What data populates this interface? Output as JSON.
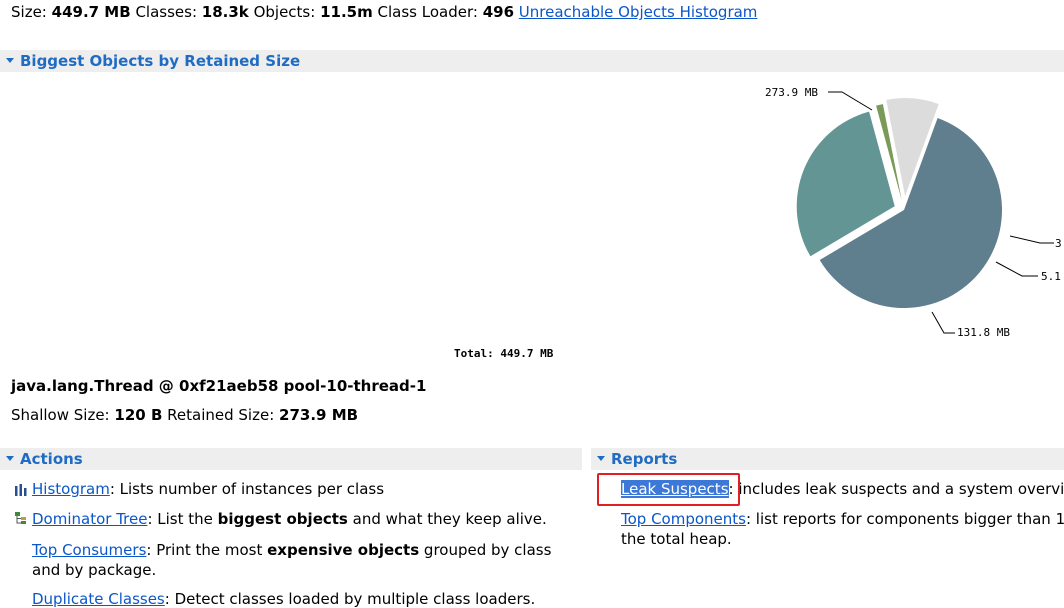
{
  "summary": {
    "size_label": "Size:",
    "size_value": "449.7 MB",
    "classes_label": "Classes:",
    "classes_value": "18.3k",
    "objects_label": "Objects:",
    "objects_value": "11.5m",
    "loader_label": "Class Loader:",
    "loader_value": "496",
    "unreachable_link": "Unreachable Objects Histogram"
  },
  "biggest": {
    "header": "Biggest Objects by Retained Size",
    "total_label": "Total:",
    "total_value": "449.7 MB"
  },
  "chart_data": {
    "type": "pie",
    "total": "449.7 MB",
    "slices": [
      {
        "label": "273.9 MB",
        "value": 273.9,
        "color": "#5f7e8e"
      },
      {
        "label": "131.8 MB",
        "value": 131.8,
        "color": "#629594"
      },
      {
        "label": "5.1",
        "value": 5.1,
        "color": "#7a9a5a"
      },
      {
        "label": "3",
        "value": 38.9,
        "color": "#dcdcdc"
      }
    ]
  },
  "object": {
    "title": "java.lang.Thread @ 0xf21aeb58 pool-10-thread-1",
    "shallow_label": "Shallow Size:",
    "shallow_value": "120 B",
    "retained_label": "Retained Size:",
    "retained_value": "273.9 MB"
  },
  "actions": {
    "header": "Actions",
    "histogram_link": "Histogram",
    "histogram_desc": ": Lists number of instances per class",
    "dominator_link": "Dominator Tree",
    "dominator_desc_a": ": List the ",
    "dominator_bold": "biggest objects",
    "dominator_desc_b": " and what they keep alive.",
    "consumers_link": "Top Consumers",
    "consumers_desc_a": ": Print the most ",
    "consumers_bold": "expensive objects",
    "consumers_desc_b": " grouped by class and by package.",
    "duplicate_link": "Duplicate Classes",
    "duplicate_desc": ": Detect classes loaded by multiple class loaders."
  },
  "reports": {
    "header": "Reports",
    "leak_link": "Leak Suspects",
    "leak_desc": ": includes leak suspects and a system overview",
    "components_link": "Top Components",
    "components_desc": ": list reports for components bigger than 1",
    "components_desc2": "the total heap."
  }
}
